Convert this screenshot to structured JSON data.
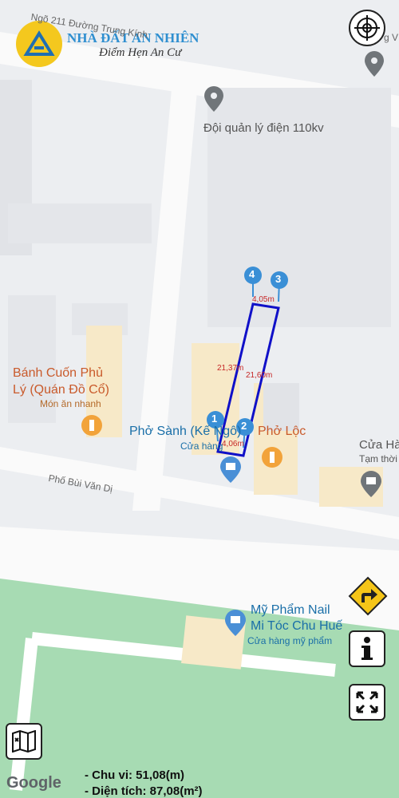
{
  "brand": {
    "name": "NHÀ ĐẤT AN NHIÊN",
    "slogan": "Điểm Hẹn An Cư"
  },
  "streets": {
    "top": "Ngõ 211 Đường Trung Kính",
    "bottom": "Phố Bùi Văn Dị"
  },
  "pois": {
    "power": "Đội quản lý điện 110kv",
    "banh_cuon_1": "Bánh Cuốn Phủ",
    "banh_cuon_2": "Lý (Quán Đồ Cổ)",
    "banh_cuon_sub": "Món ăn nhanh",
    "pho_sanh": "Phở Sành (Kế Ngô)",
    "pho_sanh_sub": "Cửa hàng",
    "pho_loc": "Phở Lộc",
    "cua_ha": "Cửa Hà",
    "cua_ha_sub": "Tạm thời",
    "nail_1": "Mỹ Phẩm Nail",
    "nail_2": "Mi Tóc Chu Huế",
    "nail_sub": "Cửa hàng mỹ phẩm",
    "edge_text": "g V"
  },
  "plot": {
    "markers": [
      "1",
      "2",
      "3",
      "4"
    ],
    "dims": {
      "top": "4,05m",
      "left": "21,37m",
      "right": "21,60m",
      "bottom": "4,06m"
    }
  },
  "measurements": {
    "perimeter": "- Chu vi: 51,08(m)",
    "area": "- Diện tích: 87,08(m²)"
  },
  "attribution": "Google",
  "icons": [
    "crosshair-icon",
    "turn-right-icon",
    "info-icon",
    "fullscreen-icon",
    "map-layers-icon"
  ],
  "colors": {
    "plot_outline": "#1010c8",
    "marker": "#3a8fd6",
    "park": "#a7dbb3"
  }
}
